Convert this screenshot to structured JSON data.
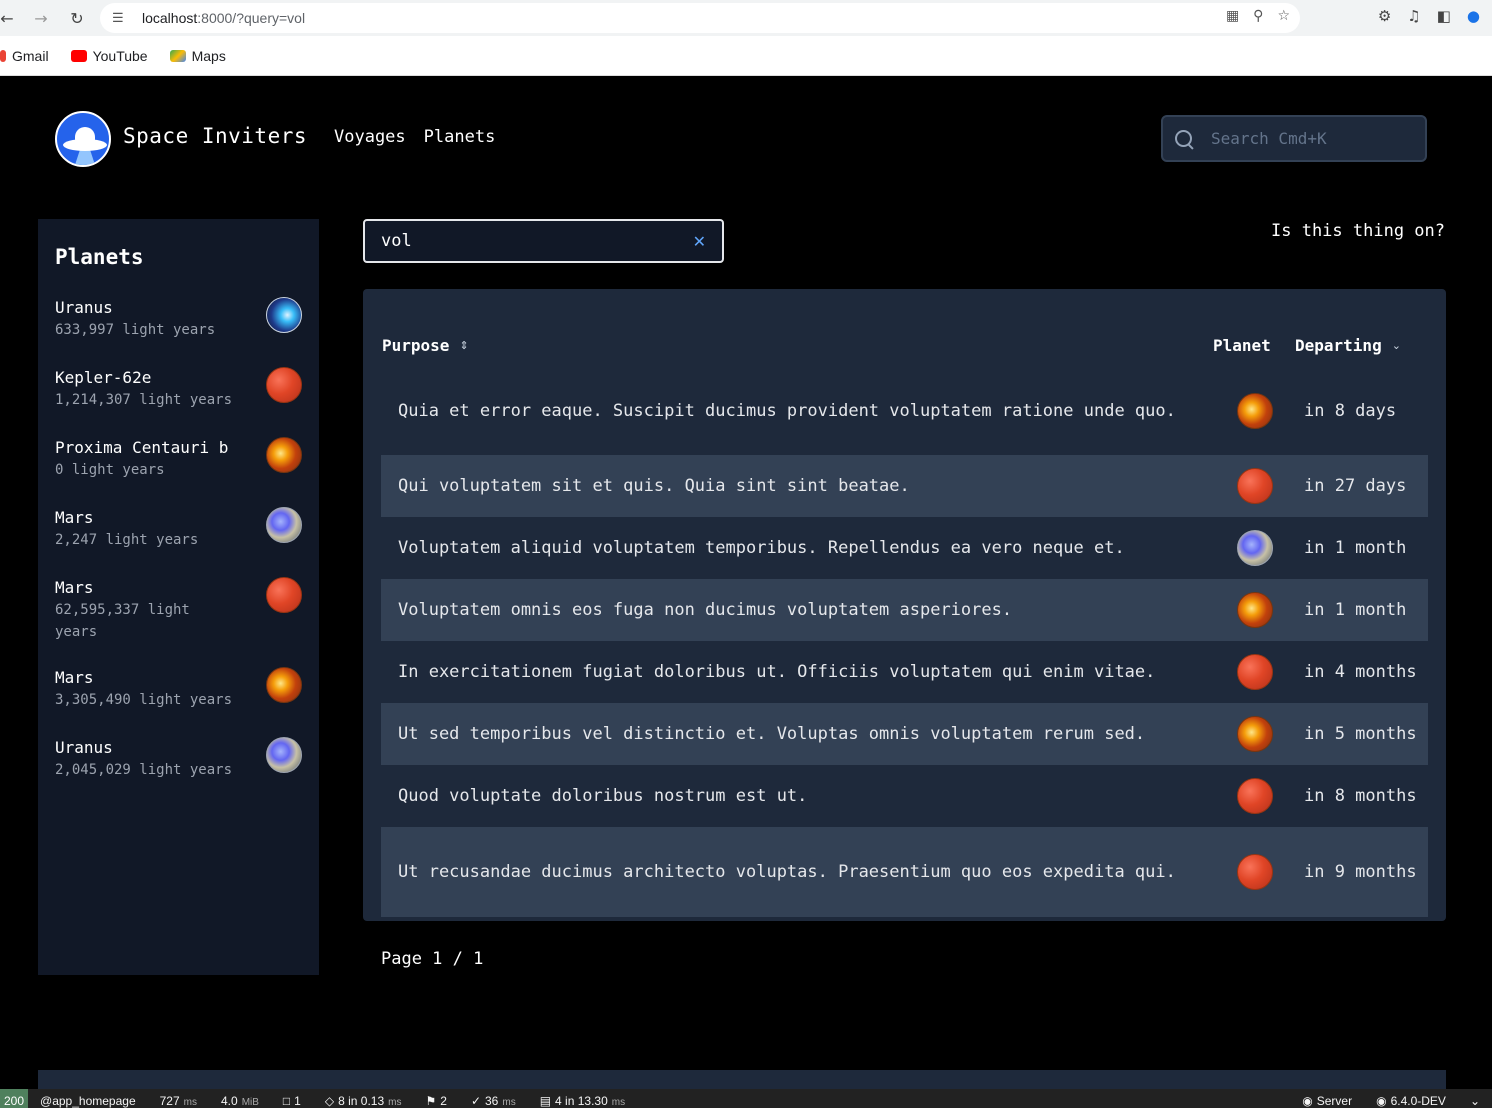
{
  "browser": {
    "url_host": "localhost",
    "url_rest": ":8000/?query=vol",
    "bookmarks": [
      {
        "label": "Gmail",
        "color": "#ea4335"
      },
      {
        "label": "YouTube",
        "color": "#ff0000"
      },
      {
        "label": "Maps",
        "color": "#34a853"
      }
    ]
  },
  "header": {
    "brand": "Space Inviters",
    "nav": [
      "Voyages",
      "Planets"
    ],
    "search_placeholder": "Search Cmd+K"
  },
  "sidebar": {
    "title": "Planets",
    "items": [
      {
        "name": "Uranus",
        "distance": "633,997 light years",
        "icon": "storm-planet"
      },
      {
        "name": "Kepler-62e",
        "distance": "1,214,307 light years",
        "icon": "red-planet"
      },
      {
        "name": "Proxima Centauri b",
        "distance": "0 light years",
        "icon": "swirl-planet"
      },
      {
        "name": "Mars",
        "distance": "2,247 light years",
        "icon": "earth-planet"
      },
      {
        "name": "Mars",
        "distance": "62,595,337 light years",
        "icon": "red-planet"
      },
      {
        "name": "Mars",
        "distance": "3,305,490 light years",
        "icon": "swirl-planet"
      },
      {
        "name": "Uranus",
        "distance": "2,045,029 light years",
        "icon": "earth-planet"
      }
    ]
  },
  "main": {
    "query_value": "vol",
    "status_text": "Is this thing on?",
    "table": {
      "headers": {
        "purpose": "Purpose",
        "planet": "Planet",
        "departing": "Departing"
      },
      "rows": [
        {
          "purpose": "Quia et error eaque. Suscipit ducimus provident voluptatem ratione unde quo.",
          "planet_icon": "swirl-planet",
          "departing": "in 8 days"
        },
        {
          "purpose": "Qui voluptatem sit et quis. Quia sint sint beatae.",
          "planet_icon": "red-planet",
          "departing": "in 27 days"
        },
        {
          "purpose": "Voluptatem aliquid voluptatem temporibus. Repellendus ea vero neque et.",
          "planet_icon": "earth-planet",
          "departing": "in 1 month"
        },
        {
          "purpose": "Voluptatem omnis eos fuga non ducimus voluptatem asperiores.",
          "planet_icon": "swirl-planet",
          "departing": "in 1 month"
        },
        {
          "purpose": "In exercitationem fugiat doloribus ut. Officiis voluptatem qui enim vitae.",
          "planet_icon": "red-planet",
          "departing": "in 4 months"
        },
        {
          "purpose": "Ut sed temporibus vel distinctio et. Voluptas omnis voluptatem rerum sed.",
          "planet_icon": "swirl-planet",
          "departing": "in 5 months"
        },
        {
          "purpose": "Quod voluptate doloribus nostrum est ut.",
          "planet_icon": "red-planet",
          "departing": "in 8 months"
        },
        {
          "purpose": "Ut recusandae ducimus architecto voluptas. Praesentium quo eos expedita qui.",
          "planet_icon": "red-planet",
          "departing": "in 9 months"
        }
      ]
    },
    "pagination": "Page 1 / 1"
  },
  "debug_bar": {
    "status_code": "200",
    "route": "@app_homepage",
    "time": "727",
    "time_unit": "ms",
    "memory": "4.0",
    "memory_unit": "MiB",
    "forms": "1",
    "twig": "8 in 0.13",
    "twig_unit": "ms",
    "events": "2",
    "cache": "36",
    "cache_unit": "ms",
    "db": "4 in 13.30",
    "db_unit": "ms",
    "server": "Server",
    "version": "6.4.0-DEV"
  }
}
